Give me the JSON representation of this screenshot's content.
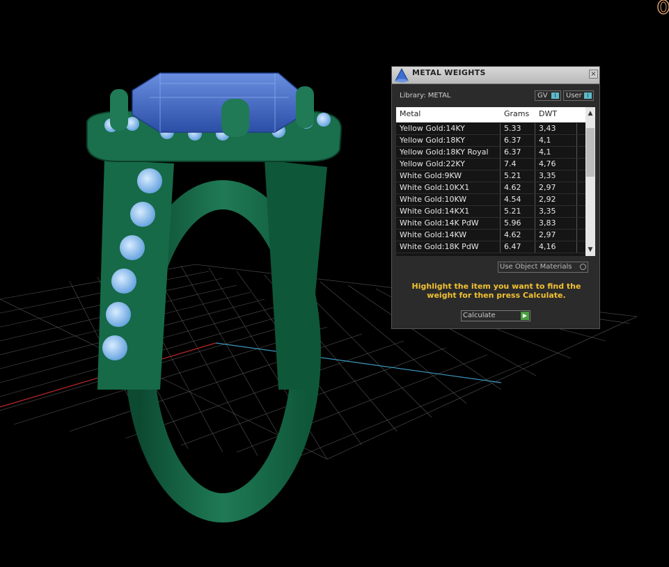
{
  "window": {
    "title": "METAL WEIGHTS",
    "close_glyph": "×",
    "icon": "app-cone-icon"
  },
  "library": {
    "label": "Library: METAL",
    "gv_label": "GV",
    "user_label": "User",
    "toggle_glyph": "I"
  },
  "table": {
    "headers": {
      "metal": "Metal",
      "grams": "Grams",
      "dwt": "DWT"
    },
    "rows": [
      {
        "metal": "Yellow Gold:14KY",
        "grams": "5.33",
        "dwt": "3,43"
      },
      {
        "metal": "Yellow Gold:18KY",
        "grams": "6.37",
        "dwt": "4,1"
      },
      {
        "metal": "Yellow Gold:18KY Royal",
        "grams": "6.37",
        "dwt": "4,1"
      },
      {
        "metal": "Yellow Gold:22KY",
        "grams": "7.4",
        "dwt": "4,76"
      },
      {
        "metal": "White Gold:9KW",
        "grams": "5.21",
        "dwt": "3,35"
      },
      {
        "metal": "White Gold:10KX1",
        "grams": "4.62",
        "dwt": "2,97"
      },
      {
        "metal": "White Gold:10KW",
        "grams": "4.54",
        "dwt": "2,92"
      },
      {
        "metal": "White Gold:14KX1",
        "grams": "5.21",
        "dwt": "3,35"
      },
      {
        "metal": "White Gold:14K PdW",
        "grams": "5.96",
        "dwt": "3,83"
      },
      {
        "metal": "White Gold:14KW",
        "grams": "4.62",
        "dwt": "2,97"
      },
      {
        "metal": "White Gold:18K PdW",
        "grams": "6.47",
        "dwt": "4,16"
      }
    ],
    "scroll_up": "▲",
    "scroll_down": "▼"
  },
  "options": {
    "use_object_materials": "Use Object Materials"
  },
  "hint": "Highlight the item you want to find the weight for then press Calculate.",
  "actions": {
    "calculate": "Calculate",
    "calculate_icon": "play-arrow-icon",
    "calculate_glyph": "▶"
  },
  "colors": {
    "ring_green": "#1f7a55",
    "stone_blue": "#3c66c4",
    "accent_diamond": "#9ec8f2",
    "hint_yellow": "#f1c232",
    "panel_bg": "#2b2b2b"
  }
}
